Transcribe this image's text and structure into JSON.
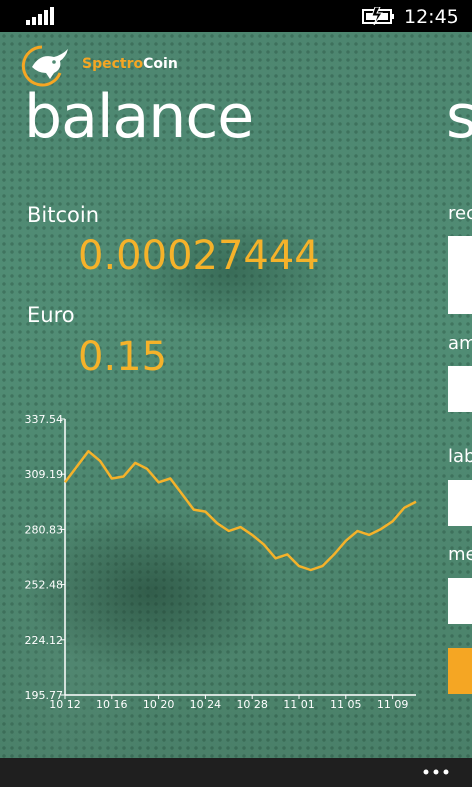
{
  "status_bar": {
    "time": "12:45",
    "icons": [
      "signal-icon",
      "battery-charging-icon"
    ]
  },
  "brand": {
    "part1": "Spectro",
    "part2": "Coin",
    "colors": {
      "accent": "#f5a623",
      "text": "#ffffff"
    }
  },
  "page": {
    "title": "balance",
    "next_title_peek": "s"
  },
  "balances": [
    {
      "label": "Bitcoin",
      "value": "0.00027444"
    },
    {
      "label": "Euro",
      "value": "0.15"
    }
  ],
  "send_panel_peek": {
    "labels": [
      "rec",
      "am",
      "lab",
      "me"
    ]
  },
  "chart_data": {
    "type": "line",
    "x": [
      "10 12",
      "10 13",
      "10 14",
      "10 15",
      "10 16",
      "10 17",
      "10 18",
      "10 19",
      "10 20",
      "10 21",
      "10 22",
      "10 23",
      "10 24",
      "10 25",
      "10 26",
      "10 27",
      "10 28",
      "10 29",
      "10 30",
      "10 31",
      "11 01",
      "11 02",
      "11 03",
      "11 04",
      "11 05",
      "11 06",
      "11 07",
      "11 08",
      "11 09",
      "11 10"
    ],
    "xticks": [
      "10 12",
      "10 16",
      "10 20",
      "10 24",
      "10 28",
      "11 01",
      "11 05",
      "11 09"
    ],
    "yticks": [
      "195.77",
      "224.12",
      "252.48",
      "280.83",
      "309.19",
      "337.54"
    ],
    "ylim": [
      195.77,
      337.54
    ],
    "series": [
      {
        "values": [
          305,
          313,
          321,
          316,
          307,
          308,
          315,
          312,
          305,
          307,
          299,
          291,
          290,
          284,
          280,
          282,
          278,
          273,
          266,
          268,
          262,
          260,
          262,
          268,
          275,
          280,
          278,
          281,
          285,
          292,
          295
        ]
      }
    ],
    "color": "#f5b22a",
    "grid": false
  },
  "app_bar": {
    "more_label": "more-options"
  }
}
